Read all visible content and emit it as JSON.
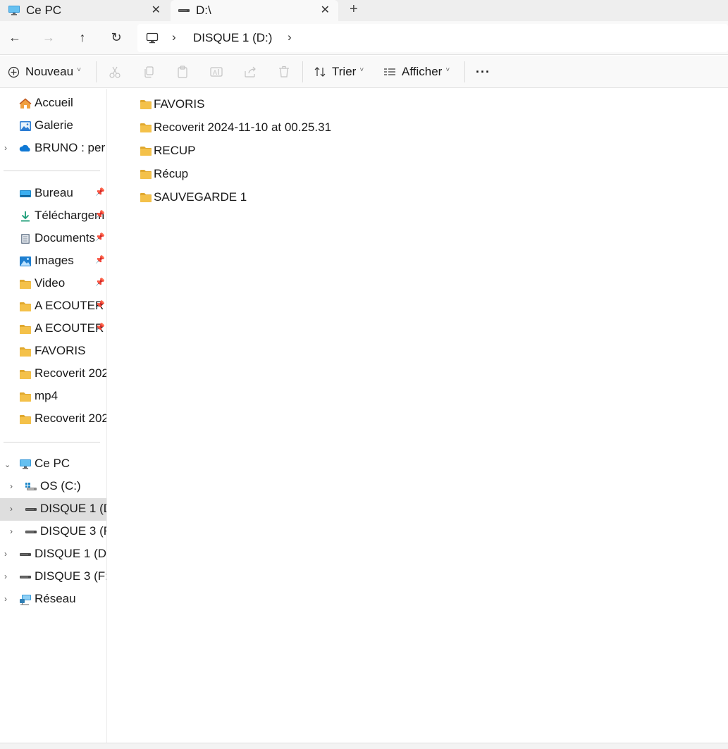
{
  "tabs": [
    {
      "title": "Ce PC",
      "icon": "monitor-icon",
      "active": false
    },
    {
      "title": "D:\\",
      "icon": "drive-icon",
      "active": true
    }
  ],
  "navigation": {
    "back": "←",
    "forward": "→",
    "up": "↑",
    "refresh": "↻",
    "breadcrumb_root_icon": "monitor-icon",
    "breadcrumb": [
      "DISQUE 1 (D:)"
    ],
    "separator": "›"
  },
  "toolbar": {
    "new_label": "Nouveau",
    "sort_label": "Trier",
    "view_label": "Afficher",
    "more_label": "···",
    "disabled_actions": [
      "cut-icon",
      "copy-icon",
      "paste-icon",
      "rename-icon",
      "share-icon",
      "delete-icon"
    ]
  },
  "sidebar": {
    "top": [
      {
        "label": "Accueil",
        "icon": "home-icon"
      },
      {
        "label": "Galerie",
        "icon": "gallery-icon"
      },
      {
        "label": "BRUNO : per",
        "icon": "onedrive-icon",
        "expandable": true
      }
    ],
    "pinned": [
      {
        "label": "Bureau",
        "icon": "desktop-icon",
        "pinned": true
      },
      {
        "label": "Téléchargem",
        "icon": "download-icon",
        "pinned": true
      },
      {
        "label": "Documents",
        "icon": "document-icon",
        "pinned": true
      },
      {
        "label": "Images",
        "icon": "pictures-icon",
        "pinned": true
      },
      {
        "label": "Video",
        "icon": "folder-icon",
        "pinned": true
      },
      {
        "label": "A ECOUTER",
        "icon": "folder-icon",
        "pinned": true
      },
      {
        "label": "A ECOUTER",
        "icon": "folder-icon",
        "pinned": true
      },
      {
        "label": "FAVORIS",
        "icon": "folder-icon",
        "pinned": false
      },
      {
        "label": "Recoverit 202",
        "icon": "folder-icon",
        "pinned": false
      },
      {
        "label": "mp4",
        "icon": "folder-icon",
        "pinned": false
      },
      {
        "label": "Recoverit 202",
        "icon": "folder-icon",
        "pinned": false
      }
    ],
    "devices": [
      {
        "label": "Ce PC",
        "icon": "monitor-icon",
        "chevron": "down",
        "indent": 0
      },
      {
        "label": "OS (C:)",
        "icon": "windows-drive-icon",
        "chevron": "right",
        "indent": 1
      },
      {
        "label": "DISQUE 1 (D",
        "icon": "drive-icon",
        "chevron": "right",
        "indent": 1,
        "selected": true
      },
      {
        "label": "DISQUE 3 (F",
        "icon": "drive-icon",
        "chevron": "right",
        "indent": 1
      },
      {
        "label": "DISQUE 1 (D",
        "icon": "drive-icon",
        "chevron": "right",
        "indent": 0
      },
      {
        "label": "DISQUE 3 (F:",
        "icon": "drive-icon",
        "chevron": "right",
        "indent": 0
      },
      {
        "label": "Réseau",
        "icon": "network-icon",
        "chevron": "right",
        "indent": 0
      }
    ],
    "pin_glyph": "📌"
  },
  "files": [
    {
      "name": "FAVORIS",
      "icon": "folder-icon"
    },
    {
      "name": "Recoverit 2024-11-10 at 00.25.31",
      "icon": "folder-icon"
    },
    {
      "name": "RECUP",
      "icon": "folder-icon"
    },
    {
      "name": "Récup",
      "icon": "folder-icon"
    },
    {
      "name": "SAUVEGARDE 1",
      "icon": "folder-icon"
    }
  ],
  "colors": {
    "folder": "#f4c14a",
    "folder_dark": "#e0a82e",
    "accent": "#0067c0",
    "selected_bg": "#dedede"
  }
}
